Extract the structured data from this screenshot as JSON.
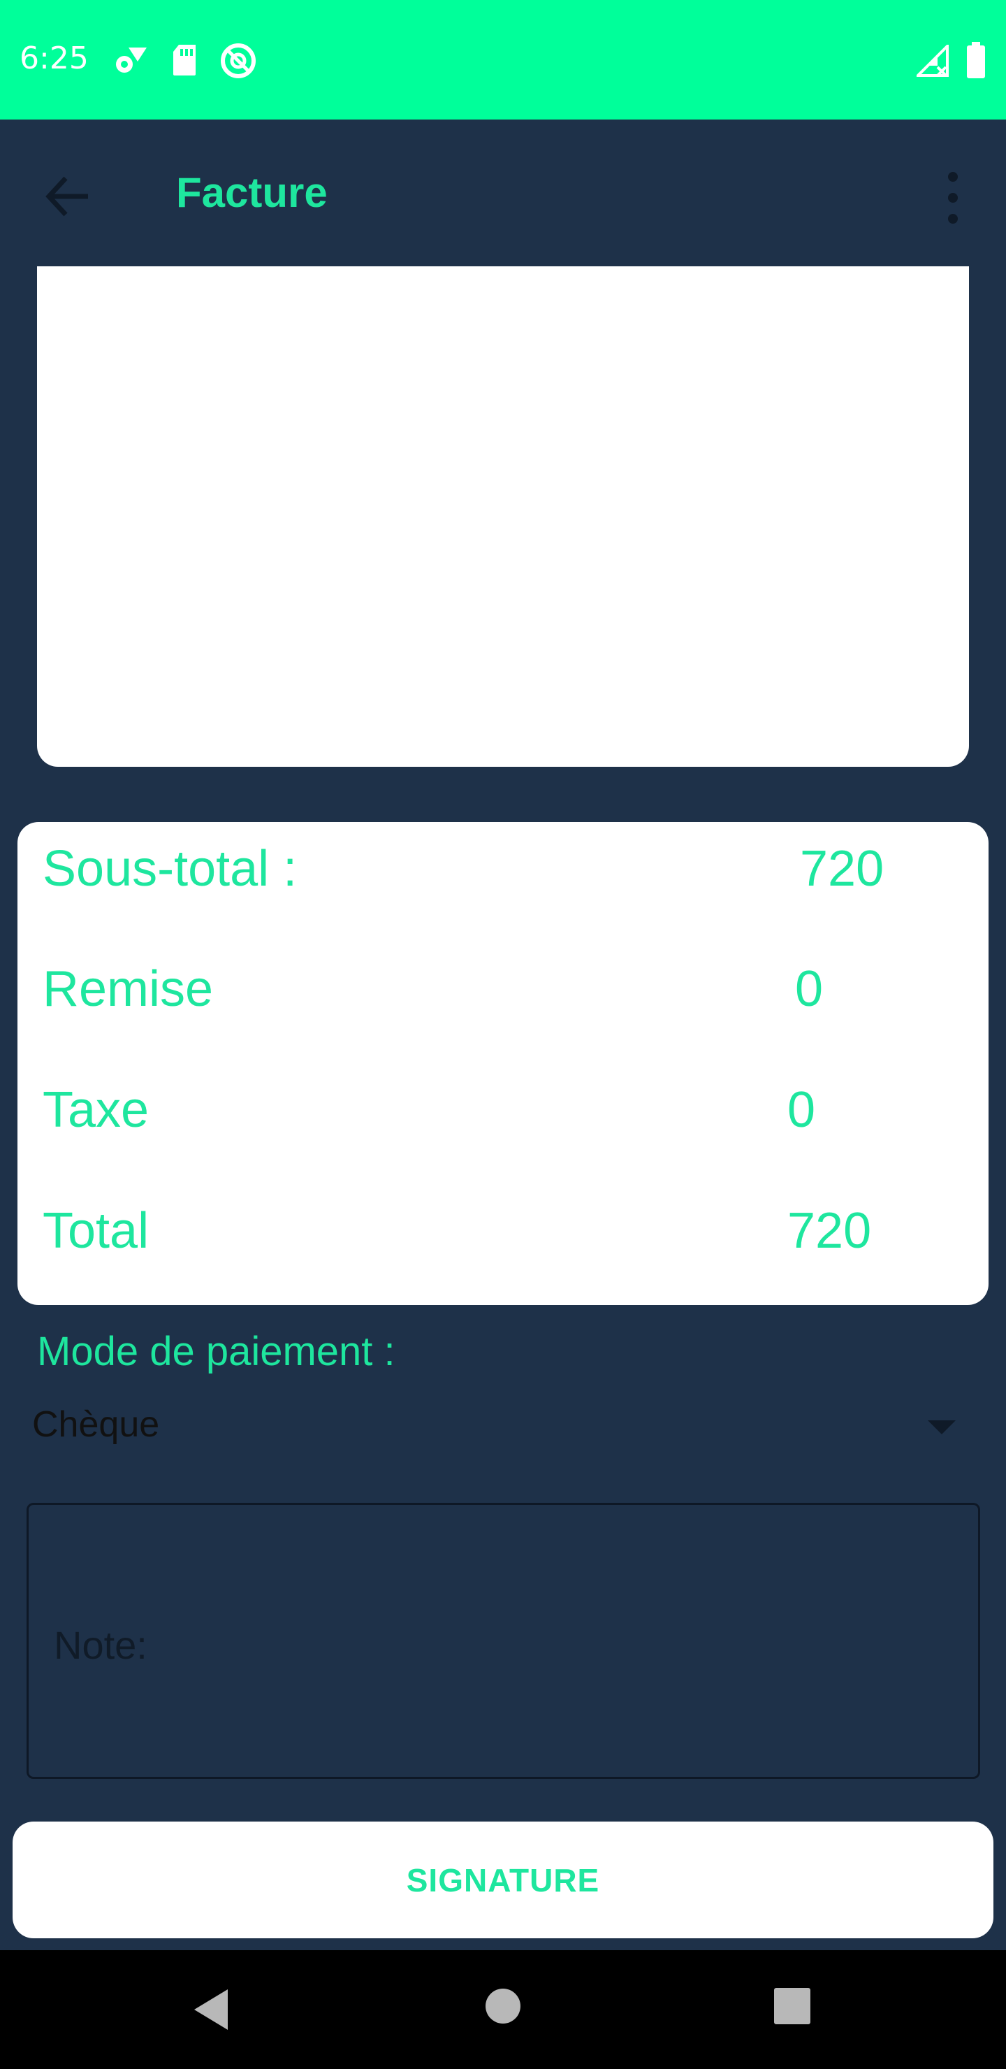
{
  "status_bar": {
    "time": "6:25",
    "icons": [
      "settings-cellular-icon",
      "sd-card-icon",
      "vpn-key-icon",
      "no-signal-icon",
      "battery-icon"
    ],
    "background": "#00ff9a"
  },
  "app_bar": {
    "title": "Facture",
    "back_icon": "arrow-left-icon",
    "menu_icon": "more-vert-icon"
  },
  "totals": {
    "subtotal_label": "Sous-total :",
    "subtotal_value": "720",
    "discount_label": "Remise",
    "discount_value": "0",
    "tax_label": "Taxe",
    "tax_value": "0",
    "total_label": "Total",
    "total_value": "720"
  },
  "payment": {
    "label": "Mode de paiement :",
    "selected": "Chèque"
  },
  "note": {
    "placeholder": "Note:",
    "value": ""
  },
  "signature_button": {
    "label": "SIGNATURE"
  },
  "nav": {
    "icons": [
      "back-triangle-icon",
      "home-circle-icon",
      "recents-square-icon"
    ]
  },
  "colors": {
    "accent": "#1ee69e",
    "background": "#1e3149",
    "card": "#ffffff"
  }
}
